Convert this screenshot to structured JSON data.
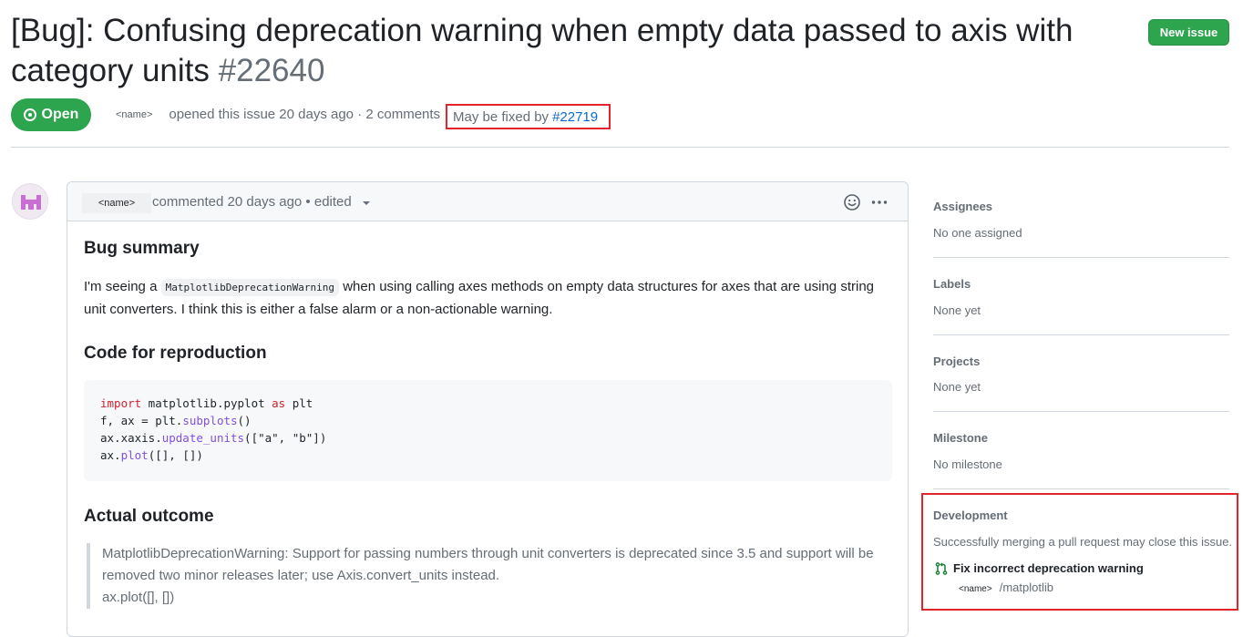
{
  "header": {
    "title": "[Bug]: Confusing deprecation warning when empty data passed to axis with category units",
    "number": "#22640",
    "new_issue_label": "New issue"
  },
  "state": {
    "label": "Open",
    "color": "#2da44e"
  },
  "meta": {
    "author": "<name>",
    "opened_text": "opened this issue 20 days ago · 2 comments",
    "fixed_by_prefix": "May be fixed by",
    "fixed_by_link": "#22719"
  },
  "comment": {
    "author": "<name>",
    "meta_text": "commented 20 days ago • edited",
    "bug_summary_heading": "Bug summary",
    "summary_pre": "I'm seeing a",
    "summary_code": "MatplotlibDeprecationWarning",
    "summary_post": "when using calling axes methods on empty data structures for axes that are using string unit converters. I think this is either a false alarm or a non-actionable warning.",
    "code_heading": "Code for reproduction",
    "code": {
      "l1_kw1": "import",
      "l1_mod": " matplotlib.pyplot ",
      "l1_kw2": "as",
      "l1_alias": " plt",
      "l2_pre": "f, ax = plt.",
      "l2_fn": "subplots",
      "l2_post": "()",
      "l3_pre": "ax.xaxis.",
      "l3_fn": "update_units",
      "l3_post": "([\"a\", \"b\"])",
      "l4_pre": "ax.",
      "l4_fn": "plot",
      "l4_post": "([], [])"
    },
    "outcome_heading": "Actual outcome",
    "outcome_line1": "MatplotlibDeprecationWarning: Support for passing numbers through unit converters is deprecated since 3.5 and support will be removed two minor releases later; use Axis.convert_units instead.",
    "outcome_line2": "ax.plot([], [])"
  },
  "sidebar": {
    "assignees_heading": "Assignees",
    "assignees_value": "No one assigned",
    "labels_heading": "Labels",
    "labels_value": "None yet",
    "projects_heading": "Projects",
    "projects_value": "None yet",
    "milestone_heading": "Milestone",
    "milestone_value": "No milestone",
    "development_heading": "Development",
    "development_text": "Successfully merging a pull request may close this issue.",
    "pr_title": "Fix incorrect deprecation warning",
    "pr_owner": "<name>",
    "pr_repo": "/matplotlib"
  },
  "icons": {
    "state": "issue-opened-icon",
    "reaction": "smiley-icon",
    "more": "kebab-horizontal-icon",
    "pull_request": "git-pull-request-icon"
  }
}
